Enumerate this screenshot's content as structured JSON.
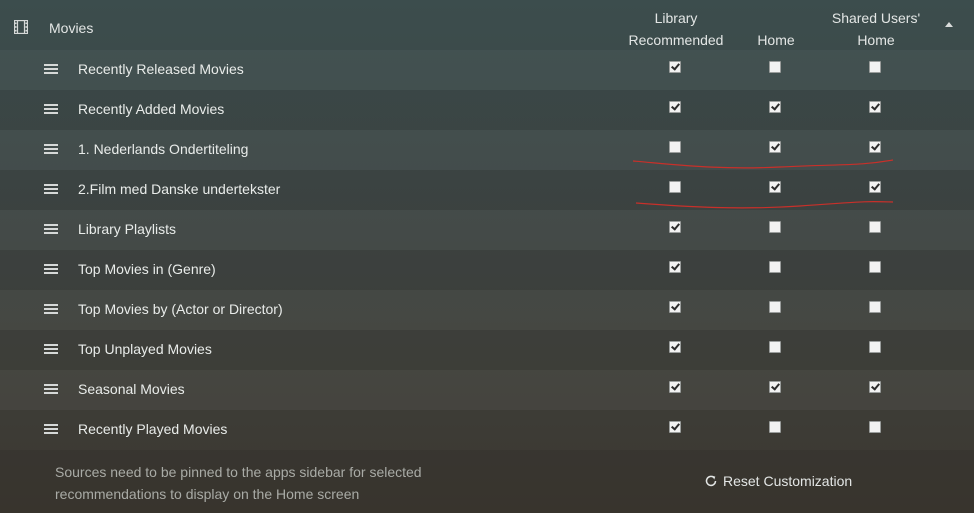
{
  "header": {
    "section_title": "Movies",
    "columns": [
      "Library\nRecommended",
      "Home",
      "Shared Users'\nHome"
    ]
  },
  "rows": [
    {
      "label": "Recently Released Movies",
      "checks": [
        true,
        false,
        false
      ]
    },
    {
      "label": "Recently Added Movies",
      "checks": [
        true,
        true,
        true
      ]
    },
    {
      "label": "1. Nederlands Ondertiteling",
      "checks": [
        false,
        true,
        true
      ]
    },
    {
      "label": "2.Film med Danske undertekster",
      "checks": [
        false,
        true,
        true
      ]
    },
    {
      "label": "Library Playlists",
      "checks": [
        true,
        false,
        false
      ]
    },
    {
      "label": "Top Movies in (Genre)",
      "checks": [
        true,
        false,
        false
      ]
    },
    {
      "label": "Top Movies by (Actor or Director)",
      "checks": [
        true,
        false,
        false
      ]
    },
    {
      "label": "Top Unplayed Movies",
      "checks": [
        true,
        false,
        false
      ]
    },
    {
      "label": "Seasonal Movies",
      "checks": [
        true,
        true,
        true
      ]
    },
    {
      "label": "Recently Played Movies",
      "checks": [
        true,
        false,
        false
      ]
    }
  ],
  "footer": {
    "note": "Sources need to be pinned to the apps sidebar for selected recommendations to display on the Home screen",
    "reset_label": "Reset Customization"
  },
  "icons": {
    "section": "film-icon",
    "collapse": "chevron-up-icon",
    "row_handle": "drag-handle-icon",
    "reset": "refresh-icon"
  },
  "colors": {
    "annotation_red": "#c8302a",
    "text": "#e9ecea",
    "muted_text": "#a9aba6"
  }
}
